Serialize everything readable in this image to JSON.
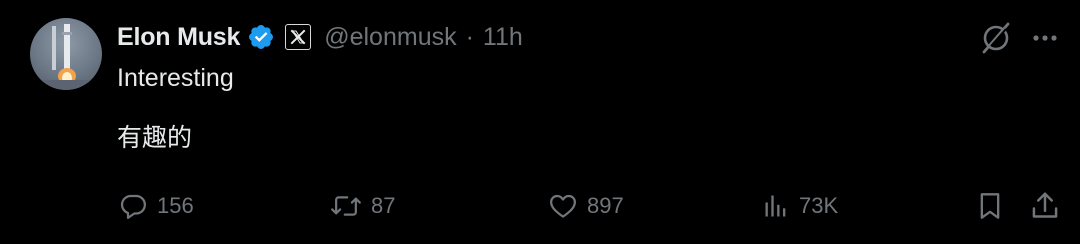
{
  "author": {
    "name": "Elon Musk",
    "handle": "@elonmusk",
    "separator": "·",
    "time": "11h"
  },
  "tweet": {
    "lines": [
      "Interesting",
      "有趣的"
    ]
  },
  "actions": {
    "replies": "156",
    "reposts": "87",
    "likes": "897",
    "views": "73K"
  },
  "icons": {
    "verified": "verified-badge-icon",
    "affiliation": "x-logo-icon",
    "grok": "grok-icon",
    "more": "more-icon",
    "reply": "reply-icon",
    "repost": "repost-icon",
    "like": "heart-icon",
    "views": "views-chart-icon",
    "bookmark": "bookmark-icon",
    "share": "share-icon"
  },
  "colors": {
    "background": "#000000",
    "primary_text": "#e7e9ea",
    "secondary_text": "#71767b",
    "verified_blue": "#1d9bf0"
  }
}
